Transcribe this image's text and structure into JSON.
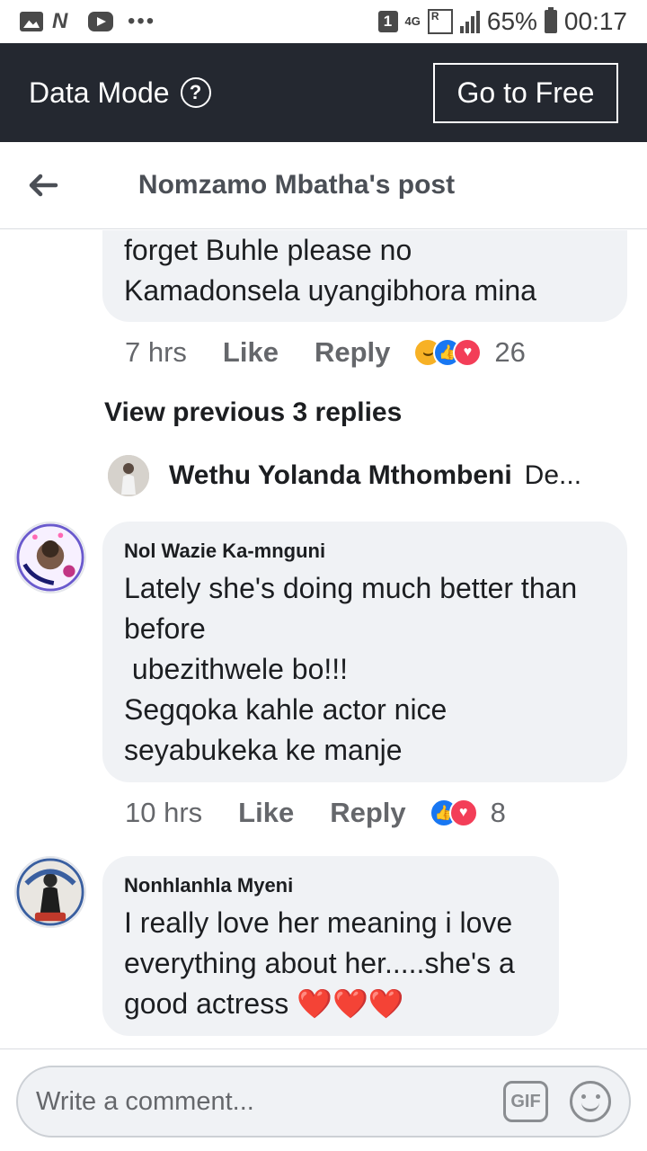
{
  "status_bar": {
    "sim_slot": "1",
    "network": "4G",
    "battery": "65%",
    "time": "00:17",
    "icons": [
      "gallery-icon",
      "n-app-icon",
      "youtube-icon",
      "more-dots-icon",
      "roaming-icon",
      "signal-icon",
      "battery-icon"
    ]
  },
  "data_mode": {
    "label": "Data Mode",
    "help_symbol": "?",
    "go_free_label": "Go to Free",
    "background": "#242830"
  },
  "header": {
    "title": "Nomzamo Mbatha's post",
    "back_icon": "back-arrow-icon"
  },
  "comments": [
    {
      "text": "forget Buhle please no\nKamadonsela uyangibhora mina",
      "time": "7 hrs",
      "like_label": "Like",
      "reply_label": "Reply",
      "reactions": [
        "haha",
        "like",
        "love"
      ],
      "reaction_count": "26"
    },
    {
      "author": "Nol Wazie Ka-mnguni",
      "avatar_badge": "LET'S GET VACCINATED",
      "text": "Lately she's doing much better than before\n ubezithwele bo!!!\nSegqoka kahle actor nice seyabukeka ke manje",
      "time": "10 hrs",
      "like_label": "Like",
      "reply_label": "Reply",
      "reactions": [
        "like",
        "love"
      ],
      "reaction_count": "8"
    },
    {
      "author": "Nonhlanhla Myeni",
      "avatar_badge_top": "CHILD OF",
      "avatar_badge_bottom": "AMEN",
      "text": "I really love her meaning i love everything about her.....she's a good actress ❤️❤️❤️"
    }
  ],
  "replies": {
    "view_previous": "View previous 3 replies",
    "latest_author": "Wethu Yolanda Mthombeni",
    "latest_snippet": "De..."
  },
  "composer": {
    "placeholder": "Write a comment...",
    "gif_label": "GIF"
  },
  "colors": {
    "bubble": "#f0f2f5",
    "like_blue": "#1877f2",
    "love_red": "#f33e58",
    "haha_yellow": "#f7b125"
  }
}
